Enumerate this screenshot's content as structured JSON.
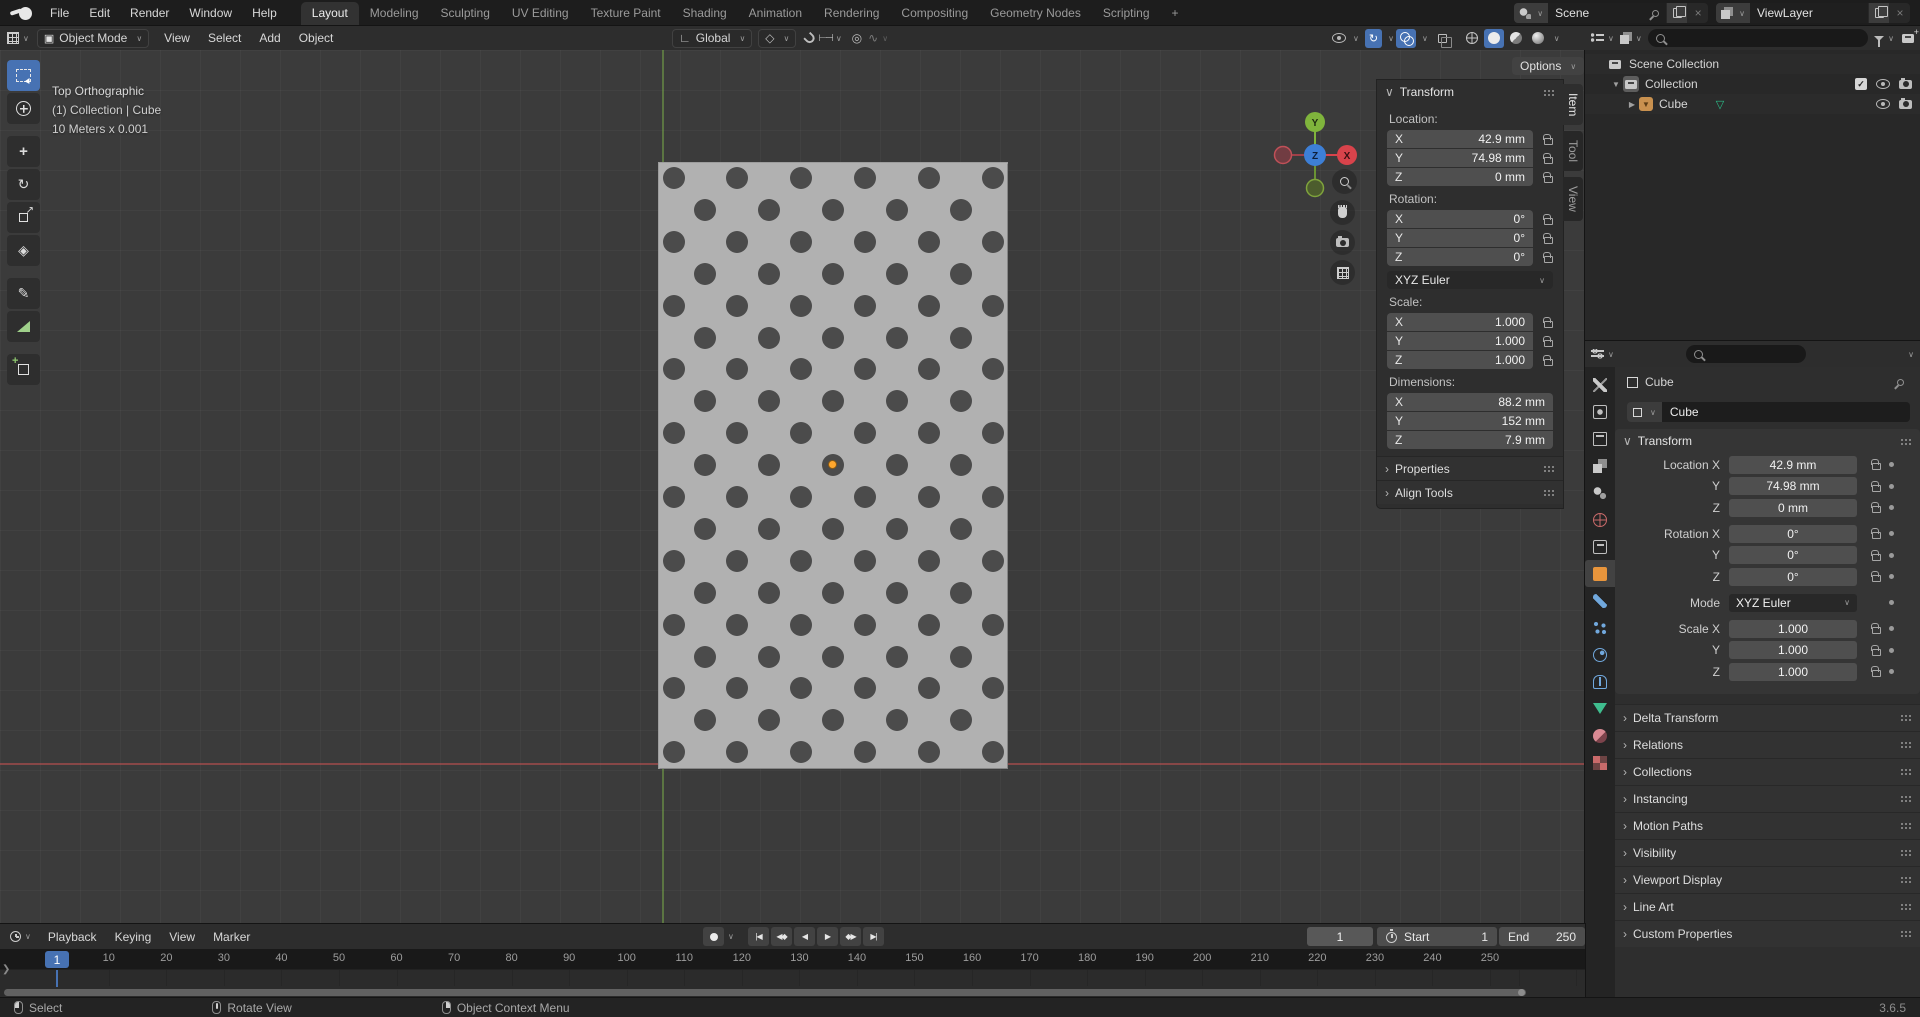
{
  "topbar": {
    "menus": [
      "File",
      "Edit",
      "Render",
      "Window",
      "Help"
    ],
    "workspaces": [
      "Layout",
      "Modeling",
      "Sculpting",
      "UV Editing",
      "Texture Paint",
      "Shading",
      "Animation",
      "Rendering",
      "Compositing",
      "Geometry Nodes",
      "Scripting",
      "+"
    ],
    "active_workspace": "Layout",
    "scene": {
      "value": "Scene"
    },
    "view_layer": {
      "value": "ViewLayer"
    }
  },
  "viewport_header": {
    "mode": "Object Mode",
    "menus": [
      "View",
      "Select",
      "Add",
      "Object"
    ],
    "orientation": "Global",
    "options_label": "Options"
  },
  "viewport": {
    "overlay_lines": [
      "Top Orthographic",
      "(1) Collection | Cube",
      "10 Meters x 0.001"
    ],
    "gizmo_axes": {
      "x": "X",
      "y": "Y",
      "z": "Z"
    },
    "plate": {
      "rows": 19,
      "holes_even_row": 6,
      "holes_odd_row": 5
    }
  },
  "toolbar": {
    "tools": [
      "select-box",
      "cursor",
      "move",
      "rotate",
      "scale",
      "transform",
      "annotate",
      "measure",
      "add-cube"
    ],
    "active_tool": "select-box"
  },
  "n_panel": {
    "tabs": [
      "Item",
      "Tool",
      "View"
    ],
    "active_tab": "Item",
    "transform_title": "Transform",
    "groups": [
      {
        "label": "Location:",
        "locks": true,
        "rows": [
          [
            "X",
            "42.9 mm"
          ],
          [
            "Y",
            "74.98 mm"
          ],
          [
            "Z",
            "0 mm"
          ]
        ]
      },
      {
        "label": "Rotation:",
        "locks": true,
        "rows": [
          [
            "X",
            "0°"
          ],
          [
            "Y",
            "0°"
          ],
          [
            "Z",
            "0°"
          ]
        ],
        "dropdown_after": "XYZ Euler"
      },
      {
        "label": "Scale:",
        "locks": true,
        "rows": [
          [
            "X",
            "1.000"
          ],
          [
            "Y",
            "1.000"
          ],
          [
            "Z",
            "1.000"
          ]
        ]
      },
      {
        "label": "Dimensions:",
        "locks": false,
        "rows": [
          [
            "X",
            "88.2 mm"
          ],
          [
            "Y",
            "152 mm"
          ],
          [
            "Z",
            "7.9 mm"
          ]
        ]
      }
    ],
    "collapsed_panels": [
      "Properties",
      "Align Tools"
    ]
  },
  "outliner": {
    "search_placeholder": "",
    "rows": [
      {
        "label": "Scene Collection",
        "depth": 0,
        "icon": "collection",
        "expander": "",
        "toggles": []
      },
      {
        "label": "Collection",
        "depth": 1,
        "icon": "collection-active",
        "expander": "▼",
        "toggles": [
          "checkbox",
          "eye",
          "camera"
        ]
      },
      {
        "label": "Cube",
        "depth": 2,
        "icon": "mesh-object",
        "expander": "▶",
        "data_icon": "▽",
        "toggles": [
          "eye",
          "camera"
        ]
      }
    ]
  },
  "properties": {
    "tabs": [
      "tool",
      "render",
      "output",
      "viewlayer",
      "scene",
      "world",
      "collection",
      "object",
      "modifiers",
      "particles",
      "physics",
      "constraints",
      "data",
      "material",
      "texture"
    ],
    "active_tab": "object",
    "breadcrumb": "Cube",
    "name_value": "Cube",
    "transform_title": "Transform",
    "rows": [
      {
        "label": "Location X",
        "value": "42.9 mm",
        "kind": "field",
        "gap": false
      },
      {
        "label": "Y",
        "value": "74.98 mm",
        "kind": "field",
        "gap": false
      },
      {
        "label": "Z",
        "value": "0 mm",
        "kind": "field",
        "gap": false
      },
      {
        "label": "Rotation X",
        "value": "0°",
        "kind": "field",
        "gap": true
      },
      {
        "label": "Y",
        "value": "0°",
        "kind": "field",
        "gap": false
      },
      {
        "label": "Z",
        "value": "0°",
        "kind": "field",
        "gap": false
      },
      {
        "label": "Mode",
        "value": "XYZ Euler",
        "kind": "dropdown",
        "gap": true
      },
      {
        "label": "Scale X",
        "value": "1.000",
        "kind": "field",
        "gap": true
      },
      {
        "label": "Y",
        "value": "1.000",
        "kind": "field",
        "gap": false
      },
      {
        "label": "Z",
        "value": "1.000",
        "kind": "field",
        "gap": false
      }
    ],
    "collapsed_panels": [
      "Delta Transform",
      "Relations",
      "Collections",
      "Instancing",
      "Motion Paths",
      "Visibility",
      "Viewport Display",
      "Line Art",
      "Custom Properties"
    ]
  },
  "timeline": {
    "menus": [
      "Playback",
      "Keying",
      "View",
      "Marker"
    ],
    "current_frame": "1",
    "ticks": [
      10,
      20,
      30,
      40,
      50,
      60,
      70,
      80,
      90,
      100,
      110,
      120,
      130,
      140,
      150,
      160,
      170,
      180,
      190,
      200,
      210,
      220,
      230,
      240,
      250
    ],
    "start_label": "Start",
    "start_value": "1",
    "end_label": "End",
    "end_value": "250",
    "transport": [
      {
        "name": "jump-to-start",
        "glyph": "|◀"
      },
      {
        "name": "previous-keyframe",
        "glyph": "◀◆"
      },
      {
        "name": "play-reverse",
        "glyph": "◀"
      },
      {
        "name": "play",
        "glyph": "▶"
      },
      {
        "name": "next-keyframe",
        "glyph": "◆▶"
      },
      {
        "name": "jump-to-end",
        "glyph": "▶|"
      }
    ]
  },
  "statusbar": {
    "hints": [
      {
        "button": "left",
        "label": "Select"
      },
      {
        "button": "middle",
        "label": "Rotate View"
      },
      {
        "button": "right",
        "label": "Object Context Menu"
      }
    ],
    "version": "3.6.5"
  },
  "icons": {
    "chevron_down": "∨",
    "collapsed_arrow": "›",
    "expanded_arrow": "∨",
    "proportional": "◎",
    "falloff": "∿",
    "pivot": "◇",
    "close": "×",
    "rotate_tool": "↻",
    "move_tool": "+",
    "transform_tool": "◈",
    "annotate_tool": "✎",
    "mode_icon": "▣"
  },
  "colors": {
    "accent": "#4772b3",
    "object_orange": "#e8953c",
    "axis_x_red": "#d8434b",
    "axis_y_green": "#7fb43c",
    "axis_z_blue": "#3d7fd6",
    "mesh_green": "#2bbf8a",
    "origin_orange": "#ffa72e"
  }
}
